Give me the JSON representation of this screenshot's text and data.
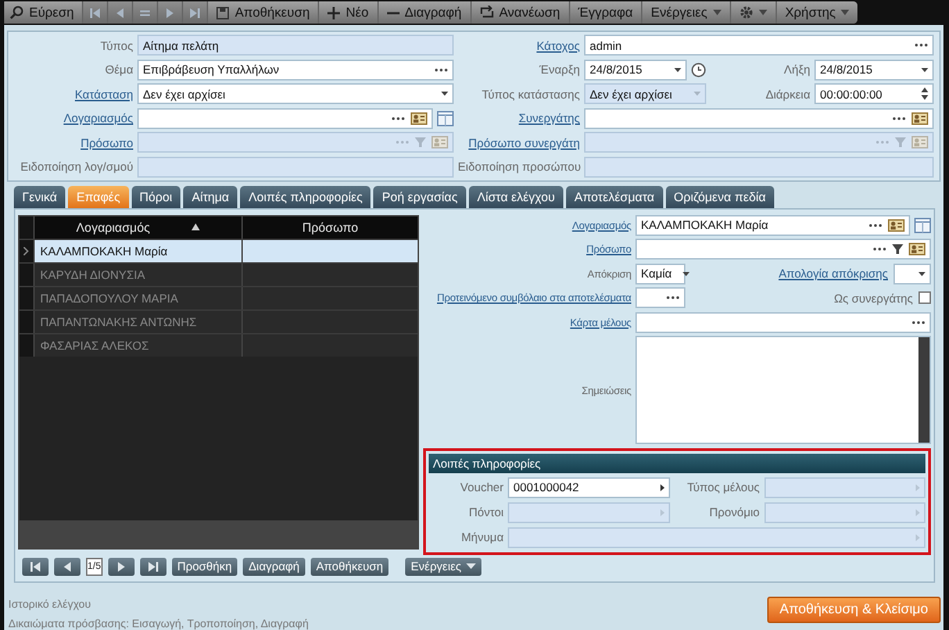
{
  "toolbar": [
    {
      "kind": "search",
      "label": "Εύρεση",
      "disabled": false
    },
    {
      "kind": "first",
      "disabled": true
    },
    {
      "kind": "prev",
      "disabled": true
    },
    {
      "kind": "list",
      "disabled": true
    },
    {
      "kind": "next",
      "disabled": true
    },
    {
      "kind": "last",
      "disabled": true
    },
    {
      "kind": "save",
      "label": "Αποθήκευση",
      "disabled": false
    },
    {
      "kind": "new",
      "label": "Νέο",
      "disabled": false
    },
    {
      "kind": "delete",
      "label": "Διαγραφή",
      "disabled": false
    },
    {
      "kind": "refresh",
      "label": "Ανανέωση",
      "disabled": false
    },
    {
      "kind": "plain",
      "label": "Έγγραφα",
      "disabled": false
    },
    {
      "kind": "menu",
      "label": "Ενέργειες",
      "disabled": false
    },
    {
      "kind": "settings_menu",
      "disabled": false
    },
    {
      "kind": "menu",
      "label": "Χρήστης",
      "disabled": false
    }
  ],
  "header_rows": [
    {
      "fields": [
        {
          "label": "Τύπος",
          "link": false,
          "field": {
            "kind": "text",
            "value": "Αίτημα πελάτη",
            "disabled": true
          }
        },
        {
          "label": "Κάτοχος",
          "link": true,
          "field": {
            "kind": "lookup",
            "value": "admin",
            "disabled": false
          }
        }
      ]
    },
    {
      "fields": [
        {
          "label": "Θέμα",
          "link": false,
          "field": {
            "kind": "lookup",
            "value": "Επιβράβευση Υπαλλήλων",
            "disabled": false
          }
        },
        {
          "label": "Έναρξη",
          "link": false,
          "field": {
            "kind": "date",
            "value": "24/8/2015",
            "disabled": false
          }
        },
        {
          "label": "Λήξη",
          "link": false,
          "field": {
            "kind": "combo",
            "value": "24/8/2015",
            "disabled": false
          }
        }
      ]
    },
    {
      "fields": [
        {
          "label": "Κατάσταση",
          "link": true,
          "field": {
            "kind": "combo",
            "value": "Δεν έχει αρχίσει",
            "disabled": false
          }
        },
        {
          "label": "Τύπος κατάστασης",
          "link": false,
          "field": {
            "kind": "combo",
            "value": "Δεν έχει αρχίσει",
            "disabled": true
          }
        },
        {
          "label": "Διάρκεια",
          "link": false,
          "field": {
            "kind": "spin",
            "value": "00:00:00:00",
            "disabled": false
          }
        }
      ]
    },
    {
      "fields": [
        {
          "label": "Λογαριασμός",
          "link": true,
          "field": {
            "kind": "account",
            "disabled": false
          }
        },
        {
          "label": "Συνεργάτης",
          "link": true,
          "field": {
            "kind": "partner",
            "disabled": false
          }
        }
      ]
    },
    {
      "fields": [
        {
          "label": "Πρόσωπο",
          "link": true,
          "field": {
            "kind": "contact",
            "disabled": true
          }
        },
        {
          "label": "Πρόσωπο συνεργάτη",
          "link": true,
          "field": {
            "kind": "contact",
            "disabled": true
          }
        }
      ]
    },
    {
      "fields": [
        {
          "label": "Ειδοποίηση λογ/σμού",
          "link": false,
          "field": {
            "kind": "text",
            "disabled": true
          }
        },
        {
          "label": "Ειδοποίηση προσώπου",
          "link": false,
          "field": {
            "kind": "text",
            "disabled": true
          }
        }
      ]
    }
  ],
  "tabs": [
    {
      "label": "Γενικά",
      "selected": false
    },
    {
      "label": "Επαφές",
      "selected": true
    },
    {
      "label": "Πόροι",
      "selected": false
    },
    {
      "label": "Αίτημα",
      "selected": false
    },
    {
      "label": "Λοιπές πληροφορίες",
      "selected": false
    },
    {
      "label": "Ροή εργασίας",
      "selected": false
    },
    {
      "label": "Λίστα ελέγχου",
      "selected": false
    },
    {
      "label": "Αποτελέσματα",
      "selected": false
    },
    {
      "label": "Οριζόμενα πεδία",
      "selected": false
    }
  ],
  "grid": {
    "columns": [
      {
        "label": "Λογαριασμός",
        "sorted": true
      },
      {
        "label": "Πρόσωπο",
        "sorted": false
      }
    ],
    "rows": [
      {
        "account": "ΚΑΛΑΜΠΟΚΑΚΗ Μαρία",
        "selected": true
      },
      {
        "account": "ΚΑΡΥΔΗ ΔΙΟΝΥΣΙΑ",
        "selected": false
      },
      {
        "account": "ΠΑΠΑΔΟΠΟΥΛΟΥ ΜΑΡΙΑ",
        "selected": false
      },
      {
        "account": "ΠΑΠΑΝΤΩΝΑΚΗΣ ΑΝΤΩΝΗΣ",
        "selected": false
      },
      {
        "account": "ΦΑΣΑΡΙΑΣ ΑΛΕΚΟΣ",
        "selected": false
      }
    ]
  },
  "contact_form": {
    "rows": [
      {
        "label": "Λογαριασμός",
        "link": true,
        "field": {
          "kind": "account",
          "value": "ΚΑΛΑΜΠΟΚΑΚΗ Μαρία",
          "disabled": false
        }
      },
      {
        "label": "Πρόσωπο",
        "link": true,
        "field": {
          "kind": "contact",
          "disabled": false
        }
      },
      {
        "label": "Απόκριση",
        "link": false,
        "field": {
          "kind": "combo",
          "value": "Καμία",
          "disabled": false
        },
        "extra": {
          "kind": "field",
          "label": "Απολογία απόκρισης",
          "link": true,
          "field": {
            "kind": "combo",
            "disabled": false
          }
        }
      },
      {
        "label": "Προτεινόμενο συμβόλαιο στα αποτελέσματα",
        "link": true,
        "field": {
          "kind": "lookup",
          "disabled": false
        },
        "extra": {
          "kind": "checkbox",
          "label": "Ως συνεργάτης",
          "checked": false
        }
      },
      {
        "label": "Κάρτα μέλους",
        "link": true,
        "field": {
          "kind": "lookup",
          "disabled": false
        }
      },
      {
        "label": "Σημειώσεις",
        "link": false,
        "field": {
          "kind": "memo",
          "disabled": false
        }
      }
    ]
  },
  "more_info": {
    "title": "Λοιπές πληροφορίες",
    "rows": [
      {
        "fields": [
          {
            "label": "Voucher",
            "field": {
              "kind": "link",
              "value": "0001000042",
              "disabled": false
            }
          },
          {
            "label": "Τύπος μέλους",
            "field": {
              "kind": "link",
              "disabled": true
            }
          }
        ]
      },
      {
        "fields": [
          {
            "label": "Πόντοι",
            "field": {
              "kind": "link",
              "disabled": true
            }
          },
          {
            "label": "Προνόμιο",
            "field": {
              "kind": "link",
              "disabled": true
            }
          }
        ]
      },
      {
        "fields": [
          {
            "label": "Μήνυμα",
            "field": {
              "kind": "link",
              "disabled": true
            }
          }
        ]
      }
    ]
  },
  "pager": {
    "page": "1/5",
    "buttons": [
      "Προσθήκη",
      "Διαγραφή",
      "Αποθήκευση"
    ],
    "actions": "Ενέργειες"
  },
  "footer": {
    "audit": "Ιστορικό ελέγχου",
    "rights": "Δικαιώματα πρόσβασης: Εισαγωγή, Τροποποίηση, Διαγραφή",
    "close_button": "Αποθήκευση & Κλείσιμο"
  }
}
